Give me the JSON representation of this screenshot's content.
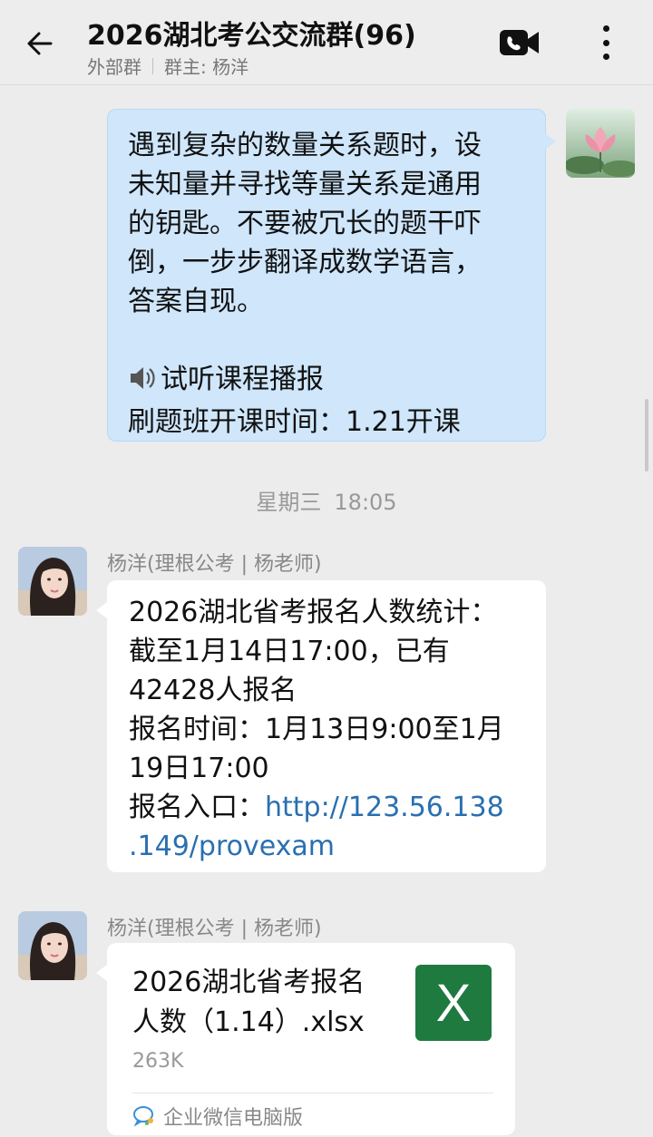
{
  "header": {
    "title": "2026湖北考公交流群(96)",
    "tag": "外部群",
    "owner": "群主: 杨洋",
    "back_icon": "arrow-left-icon",
    "video_icon": "video-call-icon",
    "more_icon": "more-vertical-icon"
  },
  "messages": {
    "outgoing": {
      "lines": [
        "遇到复杂的数量关系题时，设",
        "未知量并寻找等量关系是通用",
        "的钥匙。不要被冗长的题干吓",
        "倒，一步步翻译成数学语言，",
        "答案自现。"
      ],
      "audition": "试听课程播报",
      "class_time": "刷题班开课时间：1.21开课"
    },
    "timestamp": {
      "day": "星期三",
      "time": "18:05"
    },
    "incoming_text": {
      "sender": "杨洋(理根公考 | 杨老师)",
      "lines": [
        "2026湖北省考报名人数统计：",
        "截至1月14日17:00，已有",
        "42428人报名",
        "报名时间：1月13日9:00至1月",
        "19日17:00",
        "报名入口："
      ],
      "link_line1": "http://123.56.138",
      "link_line2": ".149/provexam"
    },
    "incoming_file": {
      "sender": "杨洋(理根公考 | 杨老师)",
      "file_name_line1": "2026湖北省考报名",
      "file_name_line2": "人数（1.14）.xlsx",
      "file_size": "263K",
      "file_icon_letter": "X",
      "source": "企业微信电脑版"
    }
  },
  "colors": {
    "outgoing_bubble": "#cfe6fb",
    "incoming_bubble": "#ffffff",
    "background": "#ececec",
    "link": "#2a6fb0",
    "excel": "#1f7a3f"
  }
}
